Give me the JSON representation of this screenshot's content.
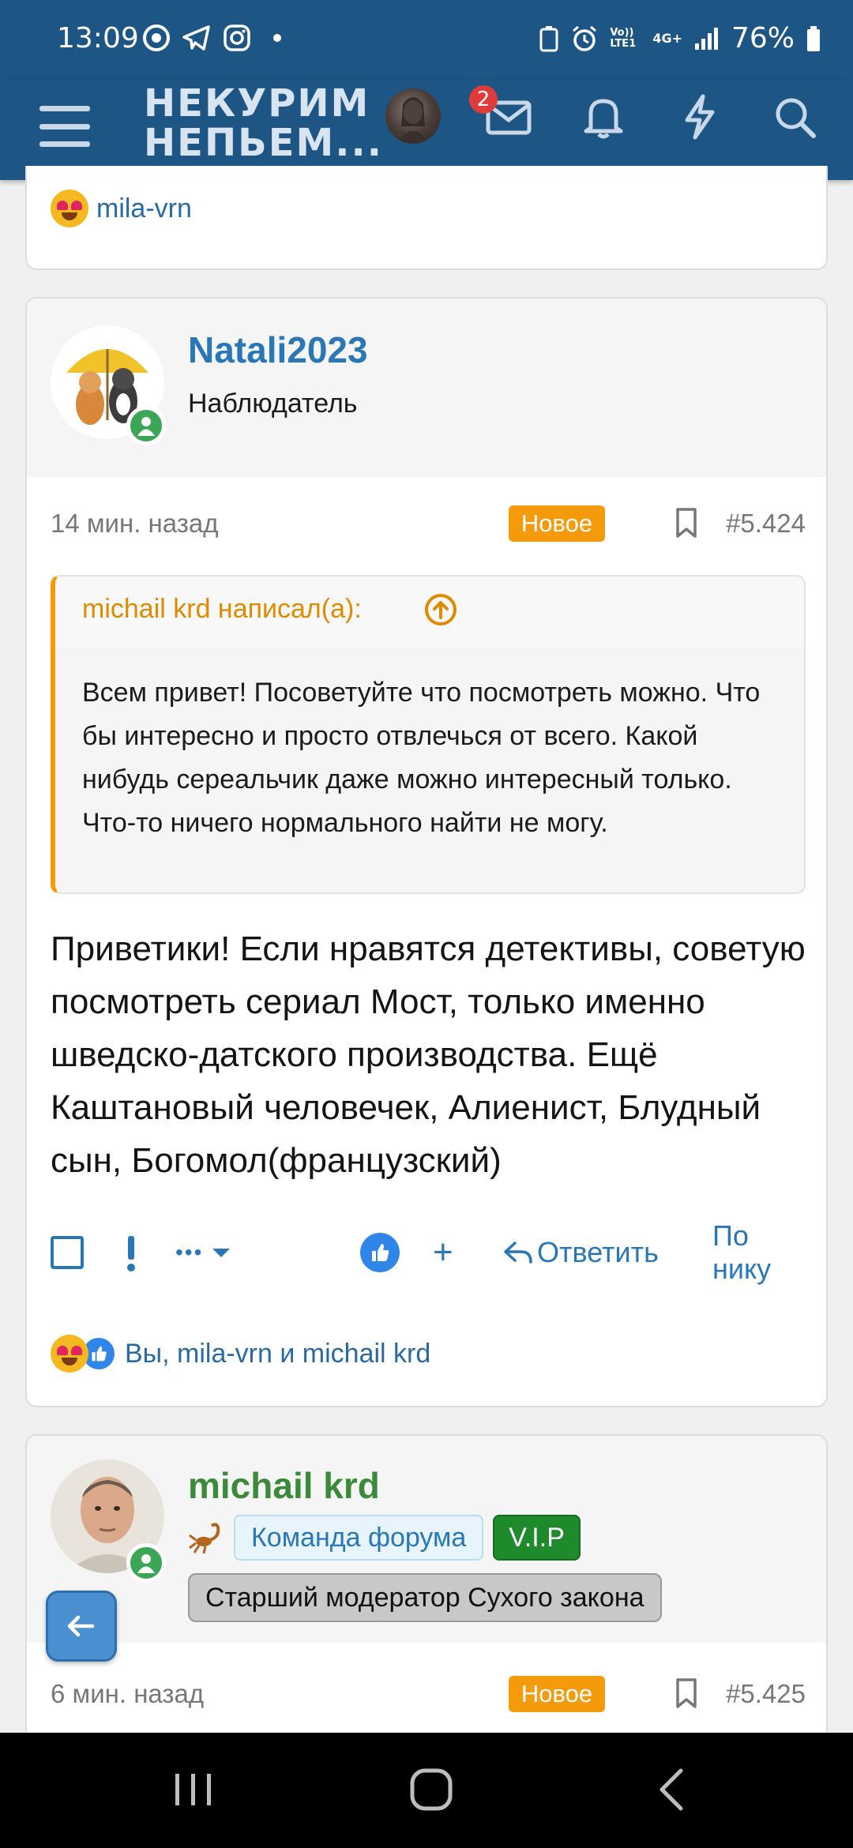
{
  "status_bar": {
    "time": "13:09",
    "battery": "76%",
    "network": "4G+",
    "volte": "Vo)) LTE1"
  },
  "header": {
    "logo_line1": "НЕКУРИМ",
    "logo_line2": "НЕПЬЕМ...",
    "inbox_badge": "2",
    "colors": {
      "header_bg": "#1d5585",
      "accent": "#2a77b8",
      "badge": "#e03b3b"
    }
  },
  "prev_post": {
    "reaction_users": "mila-vrn"
  },
  "post1": {
    "author": "Natali2023",
    "role": "Наблюдатель",
    "time": "14 мин. назад",
    "new_label": "Новое",
    "number": "#5.424",
    "quote": {
      "title": "michail krd написал(а):",
      "text": "Всем привет! Посоветуйте что посмотреть можно. Что бы интересно и просто отвлечься от всего. Какой нибудь сереальчик даже можно интересный только. Что-то ничего нормального найти не могу."
    },
    "body": "Приветики! Если нравятся детективы, советую посмотреть сериал Мост, только именно шведско-датского производства. Ещё Каштановый человечек, Алиенист, Блудный сын, Богомол(французский)",
    "actions": {
      "more": "•••",
      "reply": "Ответить",
      "by_nick": "По нику"
    },
    "reaction_users": "Вы, mila-vrn и michail krd"
  },
  "post2": {
    "author": "michail krd",
    "tag_team": "Команда форума",
    "tag_vip": "V.I.P",
    "tag_mod": "Старший модератор Сухого закона",
    "time": "6 мин. назад",
    "new_label": "Новое",
    "number": "#5.425"
  }
}
